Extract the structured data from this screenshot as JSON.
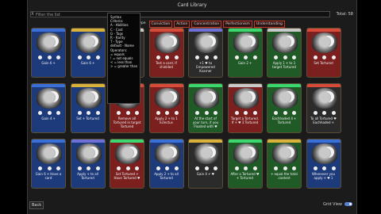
{
  "window": {
    "title": "Card Library"
  },
  "search": {
    "placeholder": "Filter the list",
    "clear": "X",
    "total": "Total: 58"
  },
  "sort": {
    "label": "Filter by Archetype",
    "tabs": [
      "Conviction",
      "Action",
      "Concentration",
      "Perfectionism",
      "Understanding"
    ]
  },
  "syntax_popup": {
    "lines": [
      "Syntax",
      "",
      "Criteria:",
      "A - Abilities",
      "C - Cost",
      "G - Tags",
      "R - Rarity",
      "T - Type",
      "default - Name",
      "",
      "Operators:",
      "= equals",
      "! = not equals",
      "< = less than",
      "> = greater than"
    ]
  },
  "card_colors": {
    "blue": "#1d3a7a",
    "red": "#7b1f1f",
    "green": "#1f5a27",
    "neutral": "#2b2b2b"
  },
  "cards": [
    {
      "color": "blue",
      "band": "#3a6fd8",
      "text": "Gain 6 ☥"
    },
    {
      "color": "blue",
      "band": "#d8b23a",
      "text": "Gain 6 ☥"
    },
    {
      "color": "neutral",
      "band": "#c9c9c9",
      "text": "Gain 4 ☥"
    },
    {
      "color": "red",
      "band": "#d84a3a",
      "text": "Test a card. If shielded"
    },
    {
      "color": "neutral",
      "band": "#6f6fd8",
      "text": "+1 ♥ to Empowered Kvarner"
    },
    {
      "color": "green",
      "band": "#3ad86f",
      "text": "Gain 2 ☥"
    },
    {
      "color": "green",
      "band": "#c9c9c9",
      "text": "Apply 1 ☥ to 1 target Tortured"
    },
    {
      "color": "red",
      "band": "#d84a3a",
      "text": "Set Tortured"
    },
    {
      "color": "blue",
      "band": "#3a6fd8",
      "text": "Gain 4 ☥"
    },
    {
      "color": "blue",
      "band": "#d8b23a",
      "text": "Set ☥ Tortured"
    },
    {
      "color": "red",
      "band": "#d84a3a",
      "text": "Remove all Tortured in target Tortured"
    },
    {
      "color": "red",
      "band": "#d84a3a",
      "text": "Apply 2 ☥ to 1 Eclectus"
    },
    {
      "color": "green",
      "band": "#3ad86f",
      "text": "At the start of your turn, if you Floated with ♥"
    },
    {
      "color": "red",
      "band": "#c9c9c9",
      "text": "Target a Tortured. If ☥ ♥ 3 Tortured"
    },
    {
      "color": "green",
      "band": "#3ad86f",
      "text": "Eachhaded 4 ☥ Tortured"
    },
    {
      "color": "neutral",
      "band": "#d84a3a",
      "text": "To all Tortured ♥ Eachhaded ☥"
    },
    {
      "color": "blue",
      "band": "#3a6fd8",
      "text": "Gain 6 ☥ Have a card"
    },
    {
      "color": "blue",
      "band": "#6f6fd8",
      "text": "Apply ☥ to all Tortured"
    },
    {
      "color": "red",
      "band": "#3ad86f",
      "text": "Set Tortured ☥ Have Tortured ♥"
    },
    {
      "color": "blue",
      "band": "#3a6fd8",
      "text": "Apply 2 ☥ to all Tortured"
    },
    {
      "color": "neutral",
      "band": "#d8b23a",
      "text": "Gain 4 ☥ ♥"
    },
    {
      "color": "green",
      "band": "#3ad86f",
      "text": "After a Tortured ♥ ☥ Tortured"
    },
    {
      "color": "green",
      "band": "#d8b23a",
      "text": "☥ equal the total content"
    },
    {
      "color": "blue",
      "band": "#3a6fd8",
      "text": "Whenever you apply ☥ ♥ 1"
    }
  ],
  "footer": {
    "back": "Back",
    "grid_view": "Grid View"
  }
}
